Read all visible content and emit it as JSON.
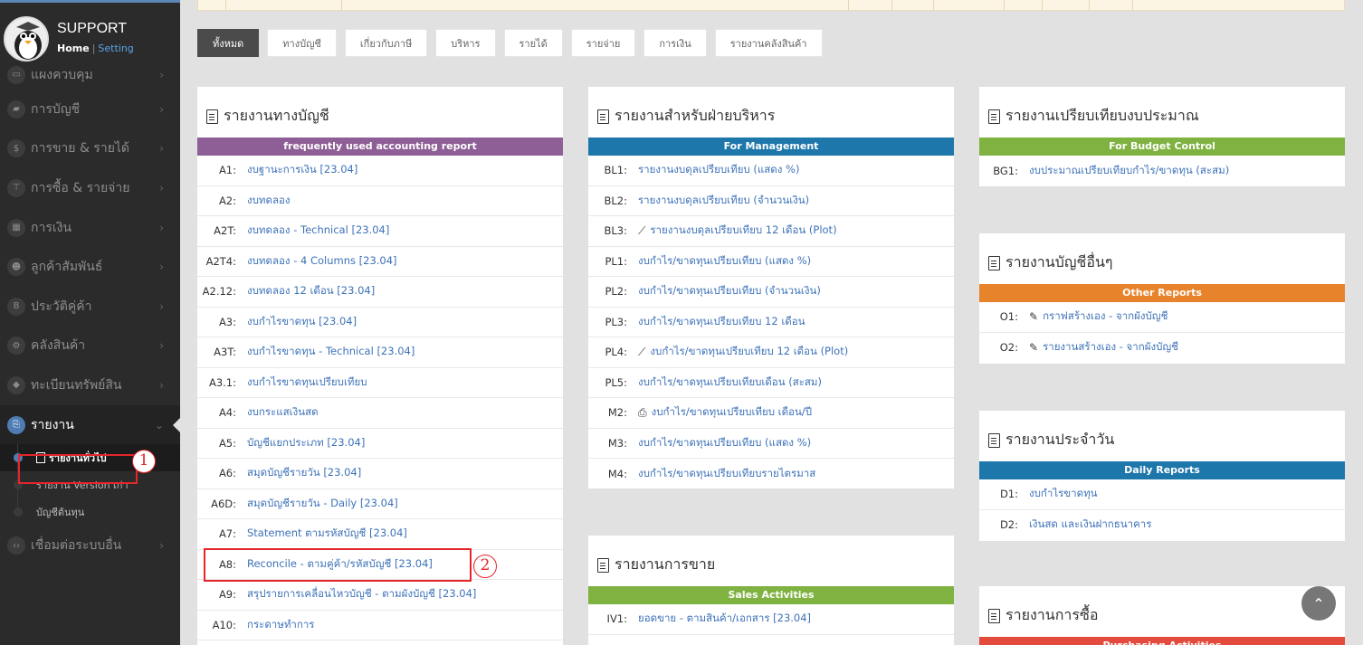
{
  "brand": {
    "title": "SUPPORT",
    "home": "Home",
    "separator": "|",
    "setting": "Setting"
  },
  "sidebar": {
    "items": [
      {
        "label": "แผงควบคุม",
        "icon": "▭"
      },
      {
        "label": "การบัญชี",
        "icon": "▰"
      },
      {
        "label": "การขาย & รายได้",
        "icon": "$"
      },
      {
        "label": "การซื้อ & รายจ่าย",
        "icon": "⊤"
      },
      {
        "label": "การเงิน",
        "icon": "▦"
      },
      {
        "label": "ลูกค้าสัมพันธ์",
        "icon": "☻"
      },
      {
        "label": "ประวัติคู่ค้า",
        "icon": "B"
      },
      {
        "label": "คลังสินค้า",
        "icon": "⚙"
      },
      {
        "label": "ทะเบียนทรัพย์สิน",
        "icon": "◆"
      },
      {
        "label": "รายงาน",
        "icon": "⎘"
      },
      {
        "label": "เชื่อมต่อระบบอื่น",
        "icon": "‹›"
      }
    ],
    "sub": [
      "รายงานทั่วไป",
      "รายงาน Version เก่า",
      "บัญชีต้นทุน"
    ],
    "arrow": "›",
    "arrow_open": "⌄"
  },
  "filters": [
    "ทั้งหมด",
    "ทางบัญชี",
    "เกี่ยวกับภาษี",
    "บริหาร",
    "รายได้",
    "รายจ่าย",
    "การเงิน",
    "รายงานคลังสินค้า"
  ],
  "panels": {
    "accounting": {
      "title": "รายงานทางบัญชี",
      "band": "frequently used accounting report",
      "band_color": "#8e5f96",
      "rows": [
        {
          "code": "A1:",
          "label": "งบฐานะการเงิน [23.04]"
        },
        {
          "code": "A2:",
          "label": "งบทดลอง"
        },
        {
          "code": "A2T:",
          "label": "งบทดลอง - Technical [23.04]"
        },
        {
          "code": "A2T4:",
          "label": "งบทดลอง - 4 Columns [23.04]"
        },
        {
          "code": "A2.12:",
          "label": "งบทดลอง 12 เดือน [23.04]"
        },
        {
          "code": "A3:",
          "label": "งบกำไรขาดทุน [23.04]"
        },
        {
          "code": "A3T:",
          "label": "งบกำไรขาดทุน - Technical [23.04]"
        },
        {
          "code": "A3.1:",
          "label": "งบกำไรขาดทุนเปรียบเทียบ"
        },
        {
          "code": "A4:",
          "label": "งบกระแสเงินสด"
        },
        {
          "code": "A5:",
          "label": "บัญชีแยกประเภท [23.04]"
        },
        {
          "code": "A6:",
          "label": "สมุดบัญชีรายวัน [23.04]"
        },
        {
          "code": "A6D:",
          "label": "สมุดบัญชีรายวัน - Daily [23.04]"
        },
        {
          "code": "A7:",
          "label": "Statement ตามรหัสบัญชี [23.04]"
        },
        {
          "code": "A8:",
          "label": "Reconcile - ตามคู่ค้า/รหัสบัญชี [23.04]"
        },
        {
          "code": "A9:",
          "label": "สรุปรายการเคลื่อนไหวบัญชี - ตามผังบัญชี [23.04]"
        },
        {
          "code": "A10:",
          "label": "กระดาษทำการ"
        }
      ]
    },
    "management": {
      "title": "รายงานสำหรับฝ่ายบริหาร",
      "band": "For Management",
      "band_color": "#1e77ab",
      "rows": [
        {
          "code": "BL1:",
          "label": "รายงานงบดุลเปรียบเทียบ (แสดง %)",
          "icon": ""
        },
        {
          "code": "BL2:",
          "label": "รายงานงบดุลเปรียบเทียบ (จำนวนเงิน)",
          "icon": ""
        },
        {
          "code": "BL3:",
          "label": "รายงานงบดุลเปรียบเทียบ 12 เดือน (Plot)",
          "icon": "⟋"
        },
        {
          "code": "PL1:",
          "label": "งบกำไร/ขาดทุนเปรียบเทียบ (แสดง %)",
          "icon": ""
        },
        {
          "code": "PL2:",
          "label": "งบกำไร/ขาดทุนเปรียบเทียบ (จำนวนเงิน)",
          "icon": ""
        },
        {
          "code": "PL3:",
          "label": "งบกำไร/ขาดทุนเปรียบเทียบ 12 เดือน",
          "icon": ""
        },
        {
          "code": "PL4:",
          "label": "งบกำไร/ขาดทุนเปรียบเทียบ 12 เดือน (Plot)",
          "icon": "⟋"
        },
        {
          "code": "PL5:",
          "label": "งบกำไร/ขาดทุนเปรียบเทียบเดือน (สะสม)",
          "icon": ""
        },
        {
          "code": "M2:",
          "label": "งบกำไร/ขาดทุนเปรียบเทียบ เดือน/ปี",
          "icon": "⎙"
        },
        {
          "code": "M3:",
          "label": "งบกำไร/ขาดทุนเปรียบเทียบ (แสดง %)",
          "icon": ""
        },
        {
          "code": "M4:",
          "label": "งบกำไร/ขาดทุนเปรียบเทียบรายไตรมาส",
          "icon": ""
        }
      ]
    },
    "sales": {
      "title": "รายงานการขาย",
      "band": "Sales Activities",
      "band_color": "#7fb241",
      "rows": [
        {
          "code": "IV1:",
          "label": "ยอดขาย - ตามสินค้า/เอกสาร [23.04]"
        }
      ]
    },
    "budget": {
      "title": "รายงานเปรียบเทียบงบประมาณ",
      "band": "For Budget Control",
      "band_color": "#7fb241",
      "rows": [
        {
          "code": "BG1:",
          "label": "งบประมาณเปรียบเทียบกำไร/ขาดทุน (สะสม)"
        }
      ]
    },
    "other": {
      "title": "รายงานบัญชีอื่นๆ",
      "band": "Other Reports",
      "band_color": "#e7832b",
      "rows": [
        {
          "code": "O1:",
          "label": "กราฟสร้างเอง - จากผังบัญชี",
          "icon": "✎"
        },
        {
          "code": "O2:",
          "label": "รายงานสร้างเอง - จากผังบัญชี",
          "icon": "✎"
        }
      ]
    },
    "daily": {
      "title": "รายงานประจำวัน",
      "band": "Daily Reports",
      "band_color": "#1e77ab",
      "rows": [
        {
          "code": "D1:",
          "label": "งบกำไรขาดทุน"
        },
        {
          "code": "D2:",
          "label": "เงินสด และเงินฝากธนาคาร"
        }
      ]
    },
    "purchase": {
      "title": "รายงานการซื้อ",
      "band": "Purchasing Activities",
      "band_color": "#e24b3e"
    }
  },
  "annotations": {
    "one": "1",
    "two": "2"
  },
  "scroll_top": "⌃"
}
